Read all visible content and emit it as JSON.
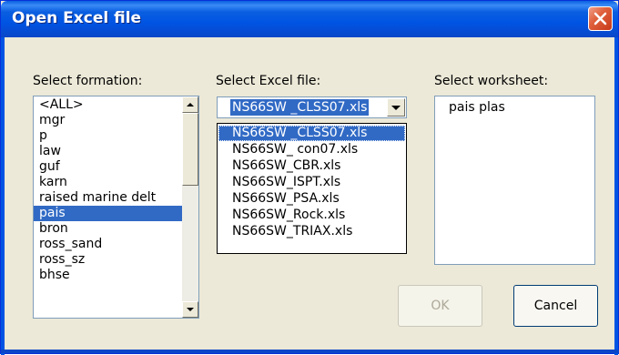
{
  "window": {
    "title": "Open Excel file"
  },
  "formation": {
    "label": "Select formation:",
    "items": [
      "<ALL>",
      "mgr",
      "p",
      "law",
      "guf",
      "karn",
      "raised marine delt",
      "pais",
      "bron",
      "ross_sand",
      "ross_sz",
      "bhse"
    ],
    "selected": "pais"
  },
  "excel": {
    "label": "Select Excel file:",
    "selected": "NS66SW _CLSS07.xls",
    "options": [
      "NS66SW _CLSS07.xls",
      "NS66SW_ con07.xls",
      "NS66SW_CBR.xls",
      "NS66SW_ISPT.xls",
      "NS66SW_PSA.xls",
      "NS66SW_Rock.xls",
      "NS66SW_TRIAX.xls"
    ]
  },
  "worksheet": {
    "label": "Select worksheet:",
    "items": [
      "pais plas"
    ]
  },
  "buttons": {
    "ok": "OK",
    "cancel": "Cancel"
  },
  "colors": {
    "title_bar": "#0054e3",
    "selection": "#316ac5",
    "dialog_bg": "#ece9d8"
  }
}
